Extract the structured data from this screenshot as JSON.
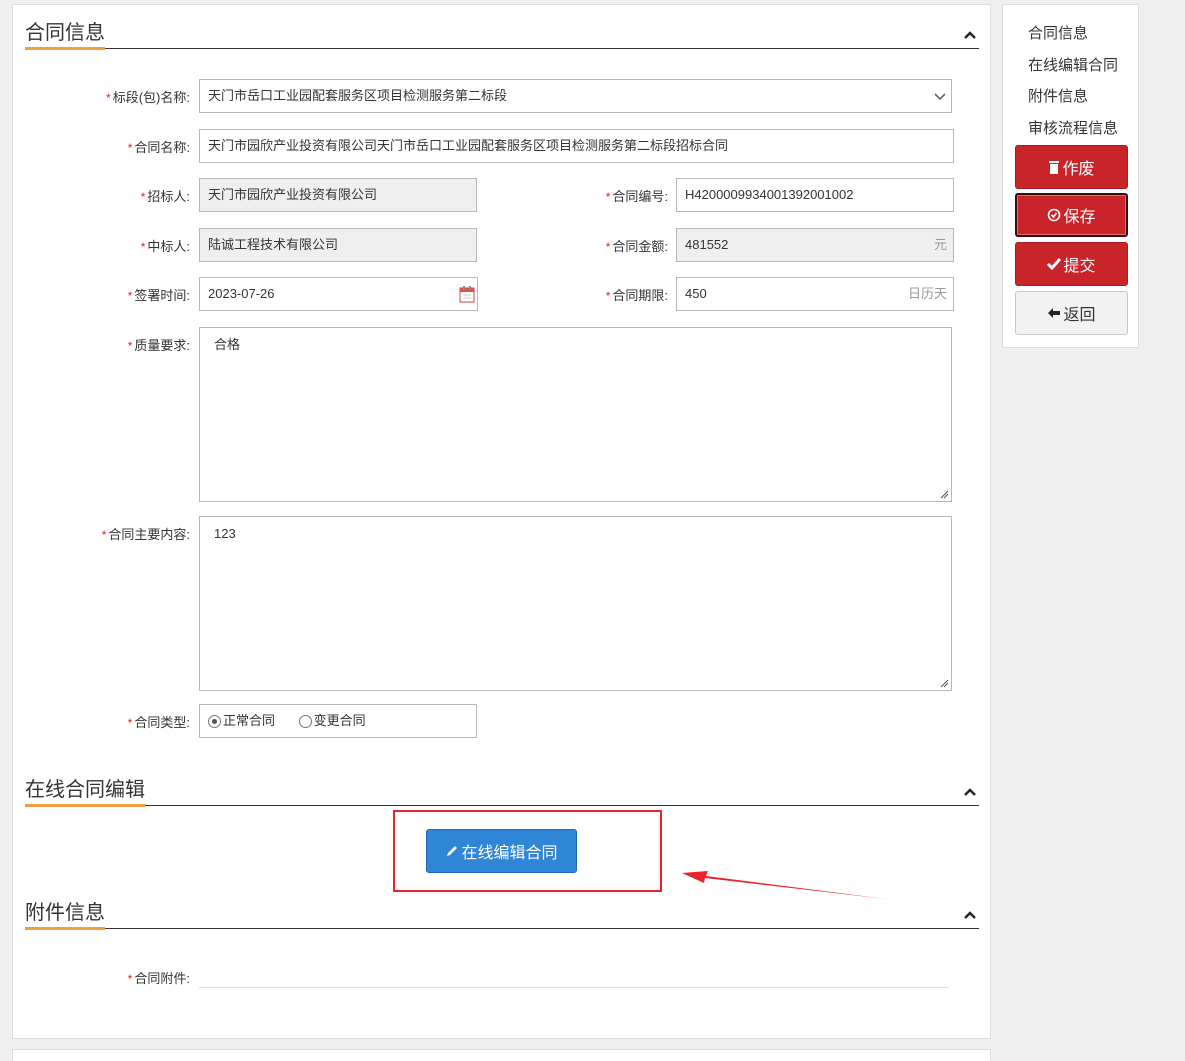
{
  "sections": {
    "contract_info": "合同信息",
    "online_edit": "在线合同编辑",
    "attachments": "附件信息"
  },
  "form": {
    "bid_section": {
      "label": "标段(包)名称:",
      "value": "天门市岳口工业园配套服务区项目检测服务第二标段"
    },
    "contract_name": {
      "label": "合同名称:",
      "value": "天门市园欣产业投资有限公司天门市岳口工业园配套服务区项目检测服务第二标段招标合同"
    },
    "tenderer": {
      "label": "招标人:",
      "value": "天门市园欣产业投资有限公司"
    },
    "contract_no": {
      "label": "合同编号:",
      "value": "H4200009934001392001002"
    },
    "winner": {
      "label": "中标人:",
      "value": "陆诚工程技术有限公司"
    },
    "amount": {
      "label": "合同金额:",
      "value": "481552",
      "unit": "元"
    },
    "sign_date": {
      "label": "签署时间:",
      "value": "2023-07-26"
    },
    "period": {
      "label": "合同期限:",
      "value": "450",
      "unit": "日历天"
    },
    "quality": {
      "label": "质量要求:",
      "value": "合格"
    },
    "main_content": {
      "label": "合同主要内容:",
      "value": "123"
    },
    "contract_type": {
      "label": "合同类型:",
      "options": [
        "正常合同",
        "变更合同"
      ],
      "selected": "正常合同"
    },
    "attachment": {
      "label": "合同附件:"
    }
  },
  "required_mark": "*",
  "online_edit_button": "在线编辑合同",
  "sidebar": {
    "links": [
      "合同信息",
      "在线编辑合同",
      "附件信息",
      "审核流程信息"
    ],
    "buttons": {
      "void": "作废",
      "save": "保存",
      "submit": "提交",
      "back": "返回"
    }
  },
  "colors": {
    "accent_underline": "#f0a040",
    "danger": "#c8242a",
    "primary": "#2f86d7",
    "required": "#d9241c",
    "highlight": "#e8232a"
  }
}
